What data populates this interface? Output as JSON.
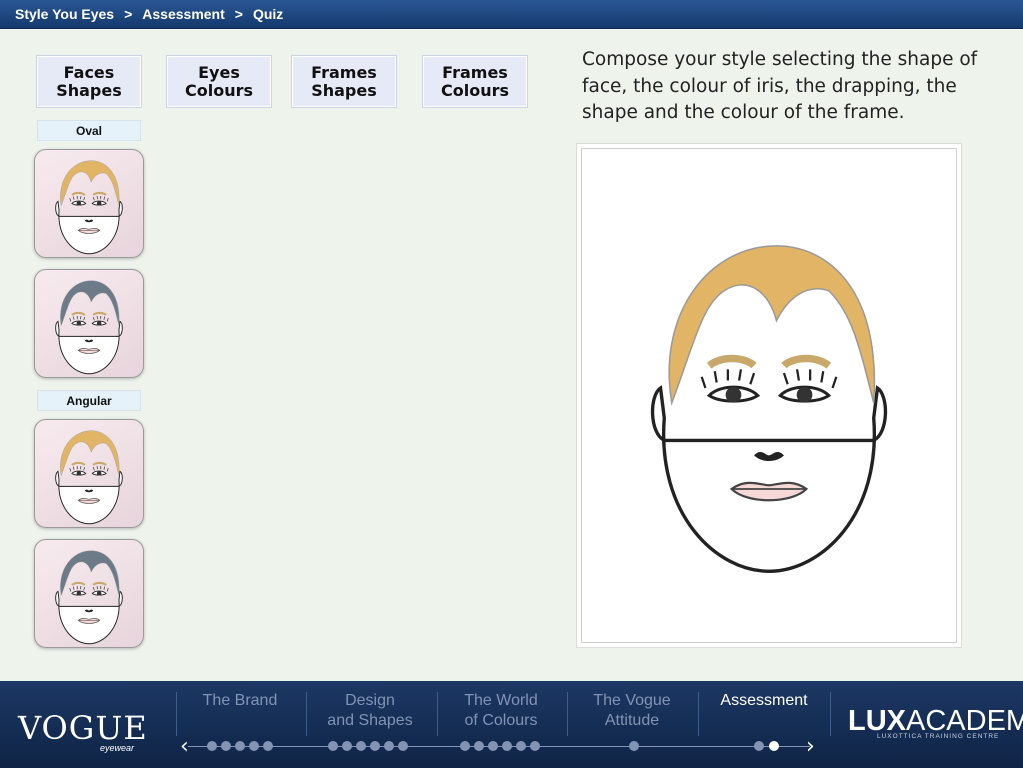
{
  "breadcrumb": [
    "Style You Eyes",
    "Assessment",
    "Quiz"
  ],
  "breadcrumb_separator": ">",
  "tabs": [
    {
      "label": "Faces\nShapes"
    },
    {
      "label": "Eyes\nColours"
    },
    {
      "label": "Frames\nShapes"
    },
    {
      "label": "Frames\nColours"
    }
  ],
  "face_groups": [
    {
      "label": "Oval",
      "thumbs": [
        {
          "hair": "#e2b566"
        },
        {
          "hair": "#6d7a88"
        }
      ]
    },
    {
      "label": "Angular",
      "thumbs": [
        {
          "hair": "#e2b566"
        },
        {
          "hair": "#6d7a88"
        }
      ]
    }
  ],
  "instructions": "Compose your style selecting the shape of face, the colour of iris, the drapping, the shape and the colour of the frame.",
  "preview": {
    "hair": "#e2b566"
  },
  "footer": {
    "brand_logo": "VOGUE",
    "brand_logo_sub": "eyewear",
    "nav": [
      {
        "label": "The Brand",
        "active": false
      },
      {
        "label": "Design\nand Shapes",
        "active": false
      },
      {
        "label": "The World\nof Colours",
        "active": false
      },
      {
        "label": "The Vogue\nAttitude",
        "active": false
      },
      {
        "label": "Assessment",
        "active": true
      }
    ],
    "academy_logo_bold": "LUX",
    "academy_logo_light": "ACADEMY",
    "academy_logo_sub": "LUXOTTICA TRAINING CENTRE",
    "prev_icon": "chevron-left-icon",
    "next_icon": "chevron-right-icon"
  }
}
